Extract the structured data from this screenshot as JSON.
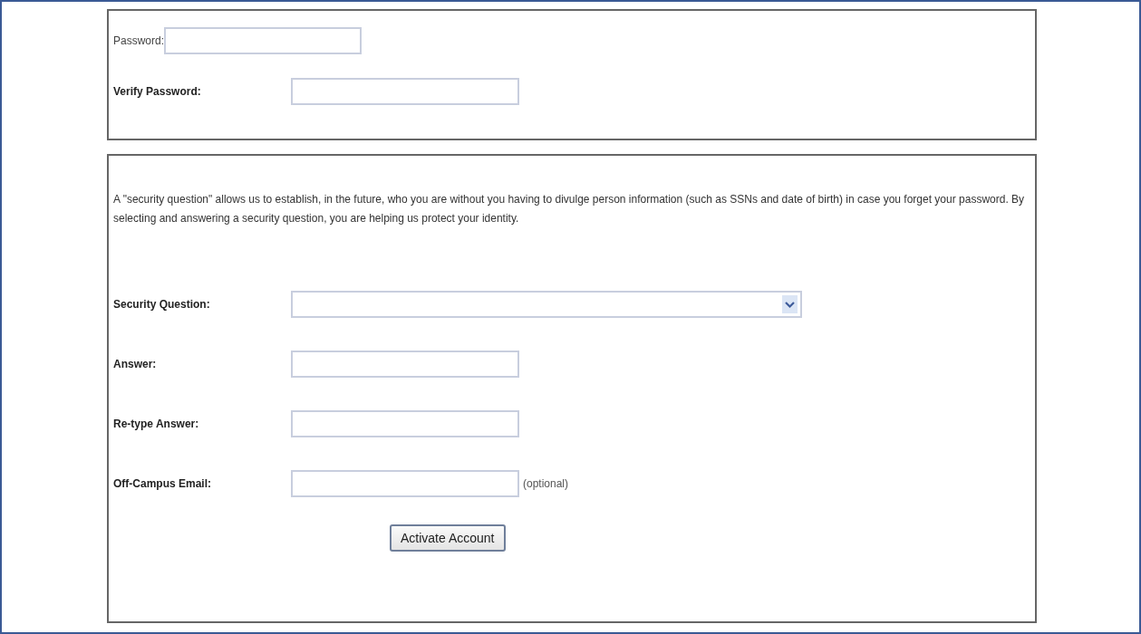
{
  "account": {
    "fields": [
      {
        "kind": "inline",
        "label": "Password:"
      },
      {
        "kind": "aligned",
        "label": "Verify Password:"
      }
    ]
  },
  "security": {
    "intro": "A \"security question\" allows us to establish, in the future, who you are without you having to divulge person information (such as SSNs and date of birth) in case you forget your password. By selecting and answering a security question, you are helping us protect your identity.",
    "fields": [
      {
        "kind": "select",
        "label": "Security Question:"
      },
      {
        "kind": "text",
        "label": "Answer:"
      },
      {
        "kind": "text",
        "label": "Re-type Answer:"
      },
      {
        "kind": "text",
        "label": "Off-Campus Email:",
        "note": "(optional)"
      }
    ],
    "button": "Activate Account"
  }
}
